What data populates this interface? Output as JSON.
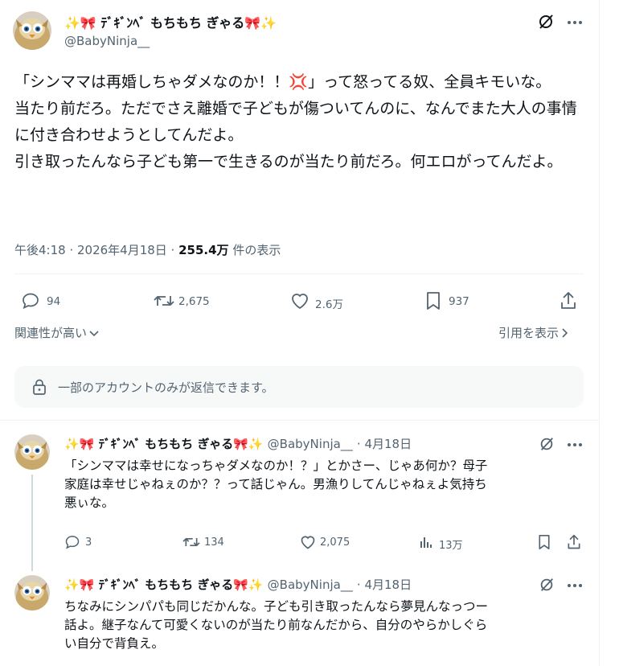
{
  "main_post": {
    "display_name": "✨🎀 ﾃﾞｷﾞﾝﾍﾞ もちもち ぎゃる🎀✨",
    "handle": "@BabyNinja__",
    "body": "「シンママは再婚しちゃダメなのか！！💢」って怒ってる奴、全員キモいな。\n当たり前だろ。ただでさえ離婚で子どもが傷ついてんのに、なんでまた大人の事情に付き合わせようとしてんだよ。\n引き取ったんなら子ども第一で生きるのが当たり前だろ。何エロがってんだよ。",
    "timestamp": "午後4:18 · 2026年4月18日 · ",
    "views": "255.4万",
    "views_suffix": " 件の表示",
    "replies": "94",
    "reposts": "2,675",
    "likes": "2.6万",
    "bookmarks": "937"
  },
  "sort_label": "関連性が高い",
  "quotes_label": "引用を表示",
  "reply_restriction": "一部のアカウントのみが返信できます。",
  "replies": [
    {
      "display_name": "✨🎀 ﾃﾞｷﾞﾝﾍﾞ もちもち ぎゃる🎀✨",
      "handle": "@BabyNinja__",
      "date": "· 4月18日",
      "body": "「シンママは幸せになっちゃダメなのか！？」とかさー、じゃあ何か？母子\n家庭は幸せじゃねぇのか？？って話じゃん。男漁りしてんじゃねぇよ気持ち\n悪ぃな。",
      "replies": "3",
      "reposts": "134",
      "likes": "2,075",
      "views": "13万"
    },
    {
      "display_name": "✨🎀 ﾃﾞｷﾞﾝﾍﾞ もちもち ぎゃる🎀✨",
      "handle": "@BabyNinja__",
      "date": "· 4月18日",
      "body": "ちなみにシンパパも同じだかんな。子ども引き取ったんなら夢見んなっつー\n話よ。継子なんて可愛くないのが当たり前なんだから、自分のやらかしぐら\nい自分で背負え。"
    }
  ],
  "colors": {
    "text": "#0f1419",
    "secondary": "#536471",
    "divider": "#eff3f4",
    "notice_bg": "#f7f9f9",
    "accent": "#1d9bf0"
  }
}
